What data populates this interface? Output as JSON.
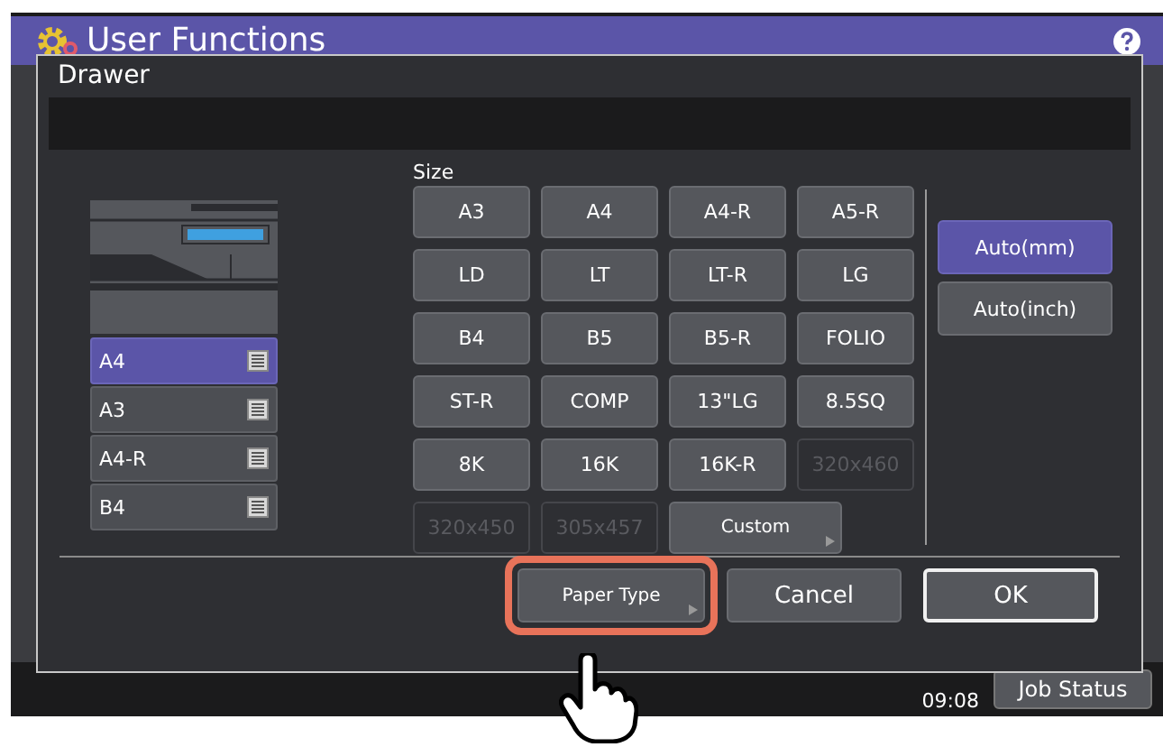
{
  "header": {
    "title": "User Functions"
  },
  "dialog": {
    "title": "Drawer",
    "size_label": "Size",
    "sizes": [
      {
        "label": "A3",
        "disabled": false
      },
      {
        "label": "A4",
        "disabled": false
      },
      {
        "label": "A4-R",
        "disabled": false
      },
      {
        "label": "A5-R",
        "disabled": false
      },
      {
        "label": "LD",
        "disabled": false
      },
      {
        "label": "LT",
        "disabled": false
      },
      {
        "label": "LT-R",
        "disabled": false
      },
      {
        "label": "LG",
        "disabled": false
      },
      {
        "label": "B4",
        "disabled": false
      },
      {
        "label": "B5",
        "disabled": false
      },
      {
        "label": "B5-R",
        "disabled": false
      },
      {
        "label": "FOLIO",
        "disabled": false
      },
      {
        "label": "ST-R",
        "disabled": false
      },
      {
        "label": "COMP",
        "disabled": false
      },
      {
        "label": "13\"LG",
        "disabled": false
      },
      {
        "label": "8.5SQ",
        "disabled": false
      },
      {
        "label": "8K",
        "disabled": false
      },
      {
        "label": "16K",
        "disabled": false
      },
      {
        "label": "16K-R",
        "disabled": false
      },
      {
        "label": "320x460",
        "disabled": true
      },
      {
        "label": "320x450",
        "disabled": true
      },
      {
        "label": "305x457",
        "disabled": true
      }
    ],
    "custom": "Custom",
    "units": [
      {
        "label": "Auto(mm)",
        "selected": true
      },
      {
        "label": "Auto(inch)",
        "selected": false
      }
    ],
    "drawers": [
      {
        "label": "A4",
        "selected": true
      },
      {
        "label": "A3",
        "selected": false
      },
      {
        "label": "A4-R",
        "selected": false
      },
      {
        "label": "B4",
        "selected": false
      }
    ],
    "actions": [
      {
        "label": "Paper Type",
        "kind": "submenu",
        "highlighted": true
      },
      {
        "label": "Cancel",
        "kind": "plain",
        "highlighted": false
      },
      {
        "label": "OK",
        "kind": "default",
        "highlighted": false
      }
    ]
  },
  "footer": {
    "time": "09:08",
    "job_status": "Job Status"
  }
}
